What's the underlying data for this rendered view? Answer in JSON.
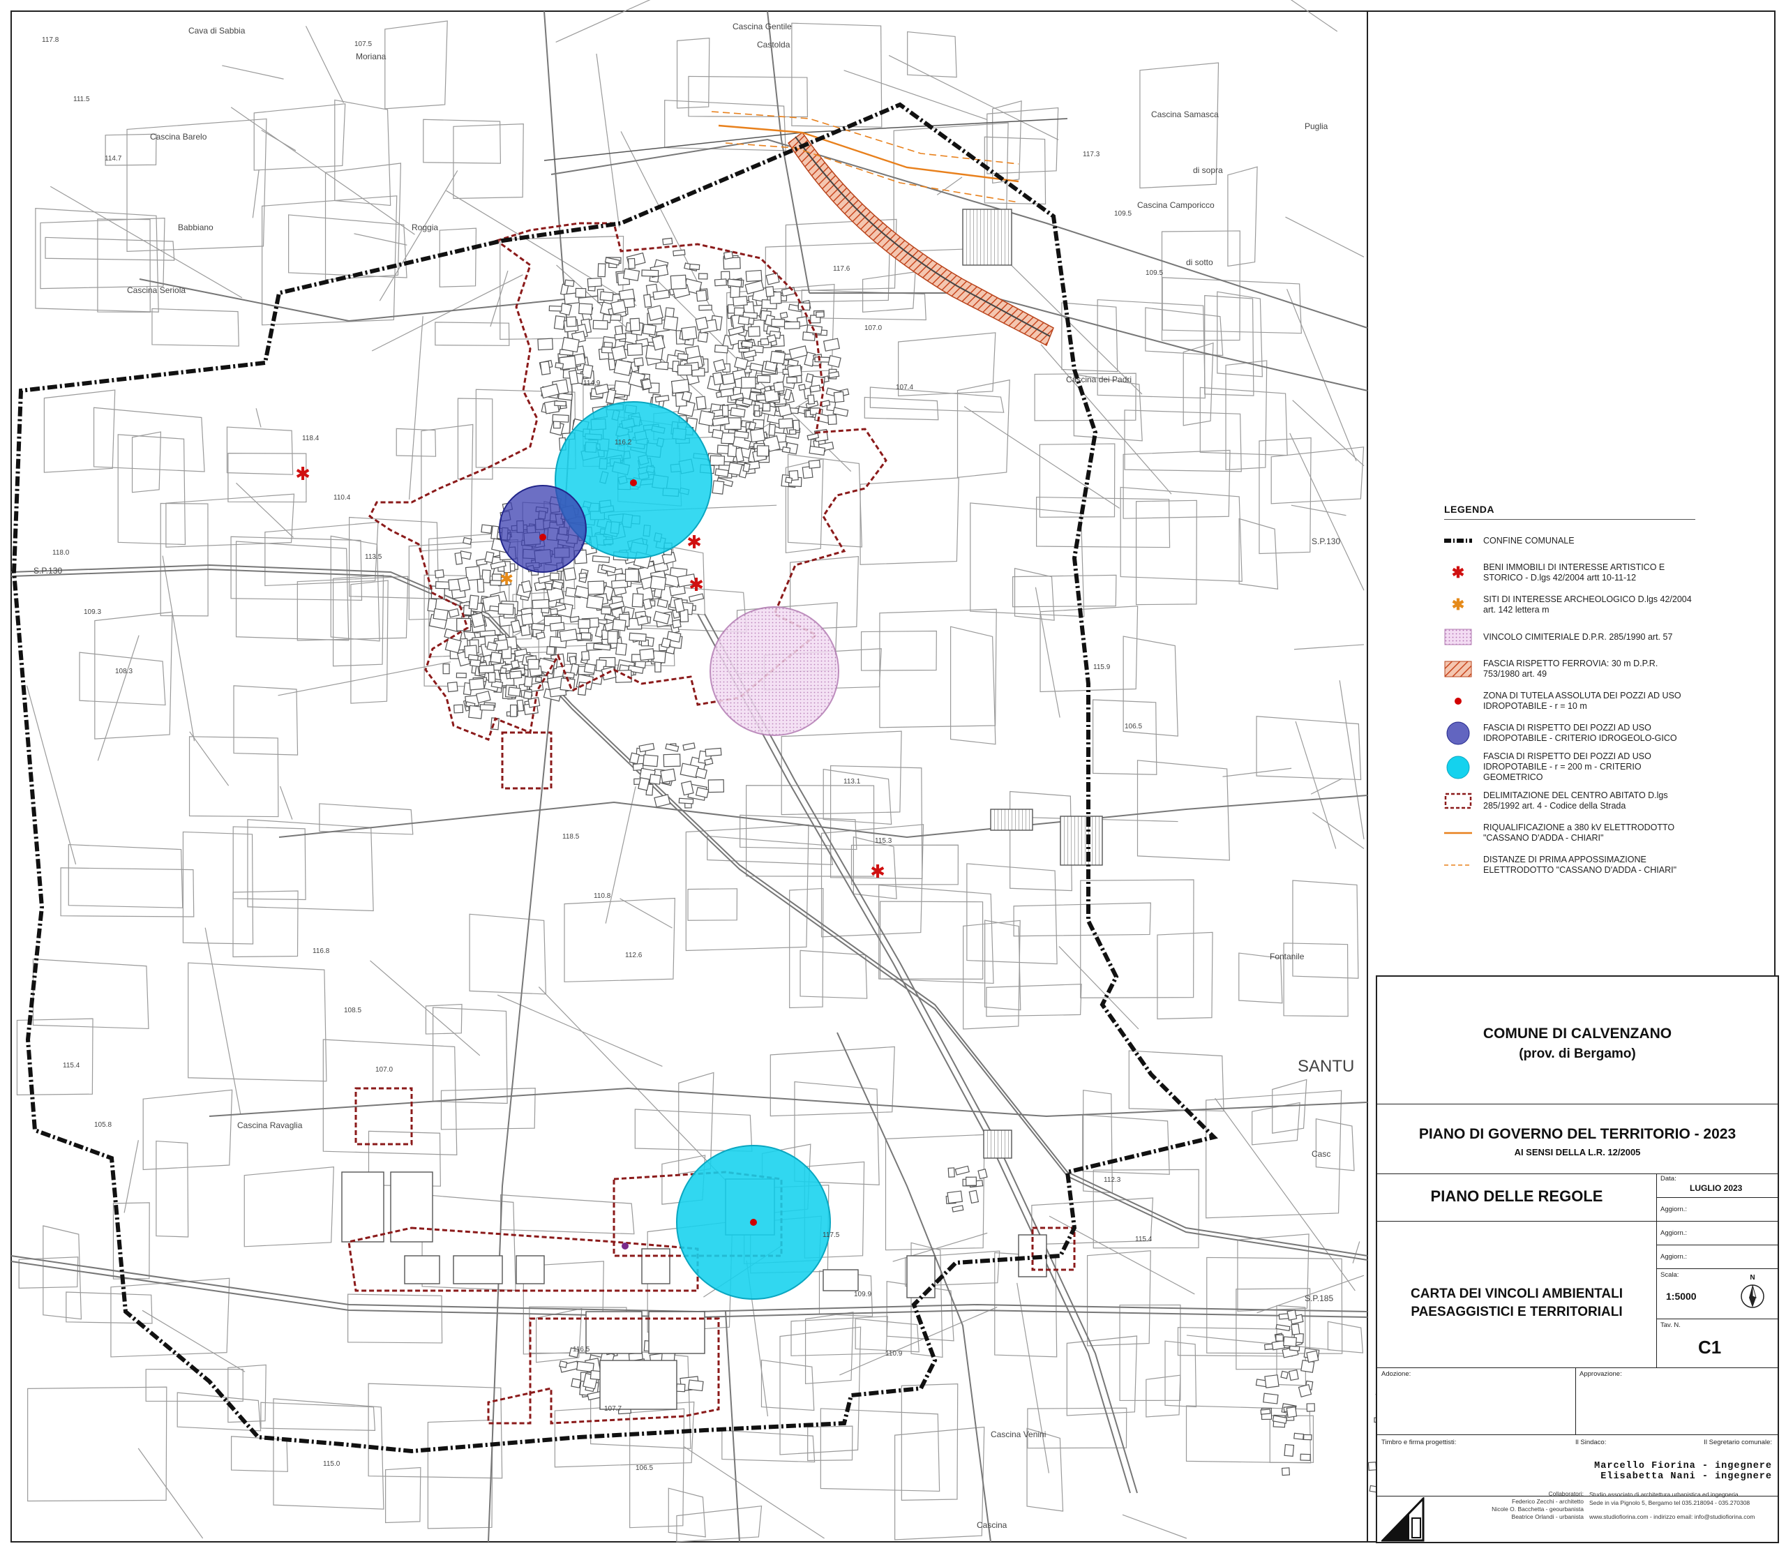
{
  "map": {
    "place_labels": [
      "Cava di Sabbia",
      "Cascina Barelo",
      "Cascina Seriola",
      "Cascina Gentile",
      "Cascina Samasca",
      "di sopra",
      "Cascina Camporicco",
      "di sotto",
      "Cascina dei Padri",
      "Cascina Ravaglia",
      "Cascina Venini",
      "Cascina",
      "SANTU",
      "Casc",
      "Roggia",
      "Babbiano",
      "S.P.130",
      "S.P.185",
      "S.P.130",
      "Fontanile",
      "Moriana",
      "Castolda",
      "Puglia"
    ],
    "elevation_labels": [
      "117.8",
      "118.4",
      "118.5",
      "117.5",
      "117.3",
      "118.0",
      "116.8",
      "116.5",
      "117.6",
      "115.9",
      "115.4",
      "115.0",
      "114.9",
      "113.1",
      "112.3",
      "111.5",
      "110.4",
      "110.8",
      "109.9",
      "109.5",
      "109.3",
      "108.5",
      "107.7",
      "107.0",
      "106.5",
      "105.8",
      "107.5",
      "116.2",
      "115.3",
      "115.4",
      "114.7",
      "113.5",
      "112.6",
      "110.9",
      "109.5",
      "108.3",
      "107.0",
      "106.5",
      "107.4"
    ]
  },
  "legend": {
    "title": "LEGENDA",
    "items": [
      {
        "id": "confine",
        "text": "CONFINE COMUNALE"
      },
      {
        "id": "beni",
        "text": "BENI IMMOBILI DI INTERESSE ARTISTICO E STORICO - D.lgs 42/2004 artt 10-11-12"
      },
      {
        "id": "siti",
        "text": "SITI DI INTERESSE ARCHEOLOGICO D.lgs 42/2004 art. 142 lettera m"
      },
      {
        "id": "cimiteriale",
        "text": "VINCOLO CIMITERIALE D.P.R. 285/1990 art. 57"
      },
      {
        "id": "ferrovia",
        "text": "FASCIA RISPETTO FERROVIA: 30 m D.P.R. 753/1980 art. 49"
      },
      {
        "id": "tutela",
        "text": "ZONA DI TUTELA ASSOLUTA DEI POZZI AD USO IDROPOTABILE - r = 10 m"
      },
      {
        "id": "idrogeo",
        "text": "FASCIA DI RISPETTO DEI POZZI AD USO IDROPOTABILE - CRITERIO IDROGEOLO-GICO"
      },
      {
        "id": "geometrico",
        "text": "FASCIA DI RISPETTO DEI POZZI AD USO IDROPOTABILE - r = 200 m - CRITERIO GEOMETRICO"
      },
      {
        "id": "centro",
        "text": "DELIMITAZIONE DEL CENTRO ABITATO D.lgs 285/1992 art. 4 - Codice della Strada"
      },
      {
        "id": "elettrodotto",
        "text": "RIQUALIFICAZIONE a 380 kV ELETTRODOTTO \"CASSANO D'ADDA - CHIARI\""
      },
      {
        "id": "distanze",
        "text": "DISTANZE DI PRIMA APPOSSIMAZIONE ELETTRODOTTO \"CASSANO D'ADDA - CHIARI\""
      }
    ],
    "colors": {
      "confine": "#111111",
      "star": "#d01010",
      "arch": "#e58a1a",
      "cimiteriale": "#d8a6d8",
      "ferrovia": "#d96a3a",
      "well_dot": "#d10000",
      "idrogeo": "#3b3fb0",
      "geometrico": "#14d2ee",
      "centro": "#8b1a1a",
      "elettrodotto": "#e8801c"
    }
  },
  "titleblock": {
    "comune": "COMUNE DI CALVENZANO",
    "provincia": "(prov. di Bergamo)",
    "piano": "PIANO DI GOVERNO DEL TERRITORIO - 2023",
    "sensi": "AI SENSI DELLA L.R. 12/2005",
    "regole": "PIANO DELLE REGOLE",
    "data_label": "Data:",
    "data_value": "LUGLIO 2023",
    "aggiorn1": "Aggiorn.:",
    "aggiorn2": "Aggiorn.:",
    "aggiorn3": "Aggiorn.:",
    "carta_line1": "CARTA DEI VINCOLI AMBIENTALI",
    "carta_line2": "PAESAGGISTICI E TERRITORIALI",
    "scala_label": "Scala:",
    "scala_value": "1:5000",
    "north": "N",
    "tav_label": "Tav. N.",
    "tav_value": "C1",
    "adozione": "Adozione:",
    "approvazione": "Approvazione:",
    "timbro": "Timbro e firma progettisti:",
    "sindaco": "Il Sindaco:",
    "segretario": "Il Segretario comunale:",
    "firm1": "Marcello Fiorina - ingegnere",
    "firm2": "Elisabetta Nani - ingegnere",
    "collab_title": "Collaboratori:",
    "collab1": "Federico Zecchi - architetto",
    "collab2": "Nicole O. Bacchetta - geourbanista",
    "collab3": "Beatrice Orlandi - urbanista",
    "studio1": "Studio associato di architettura urbanistica ed ingegneria",
    "studio2": "Sede in via Pignolo 5, Bergamo tel 035.218094 - 035.270308",
    "studio3": "www.studiofiorina.com - indirizzo email: info@studiofiorina.com"
  }
}
